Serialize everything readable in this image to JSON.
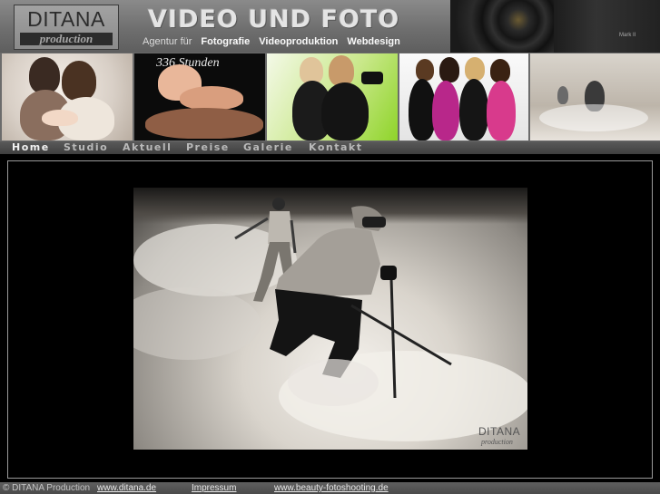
{
  "header": {
    "logo_top": "DITANA",
    "logo_bottom": "production",
    "title": "VIDEO UND FOTO",
    "agentur_lead": "Agentur  für",
    "services": [
      "Fotografie",
      "Videoproduktion",
      "Webdesign"
    ],
    "camera_label": "Mark II"
  },
  "strip": {
    "caption": "336 Stunden"
  },
  "nav": {
    "items": [
      "Home",
      "Studio",
      "Aktuell",
      "Preise",
      "Galerie",
      "Kontakt"
    ],
    "active": "Home"
  },
  "main": {
    "watermark_top": "DITANA",
    "watermark_bottom": "production"
  },
  "footer": {
    "copyright": "© DITANA Production",
    "links": [
      "www.ditana.de",
      "Impressum",
      "www.beauty-fotoshooting.de"
    ]
  },
  "colors": {
    "background": "#000000",
    "header": "#7a7a7a",
    "nav_active": "#f2f2f2",
    "nav_inactive": "#b9b9b9"
  }
}
